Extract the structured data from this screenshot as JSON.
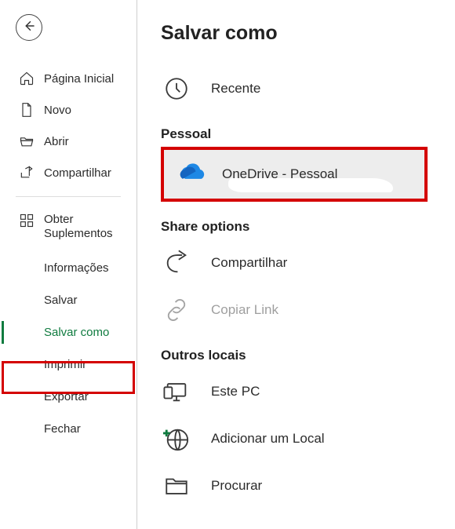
{
  "sidebar": {
    "items": [
      {
        "label": "Página Inicial"
      },
      {
        "label": "Novo"
      },
      {
        "label": "Abrir"
      },
      {
        "label": "Compartilhar"
      },
      {
        "label": "Obter Suplementos"
      }
    ],
    "sub": [
      {
        "label": "Informações"
      },
      {
        "label": "Salvar"
      },
      {
        "label": "Salvar como"
      },
      {
        "label": "Imprimir"
      },
      {
        "label": "Exportar"
      },
      {
        "label": "Fechar"
      }
    ]
  },
  "main": {
    "title": "Salvar como",
    "recent": "Recente",
    "section_pessoal": "Pessoal",
    "onedrive": "OneDrive - Pessoal",
    "section_share": "Share options",
    "share": "Compartilhar",
    "copy_link": "Copiar Link",
    "section_outros": "Outros locais",
    "este_pc": "Este PC",
    "add_local": "Adicionar um Local",
    "procurar": "Procurar"
  }
}
